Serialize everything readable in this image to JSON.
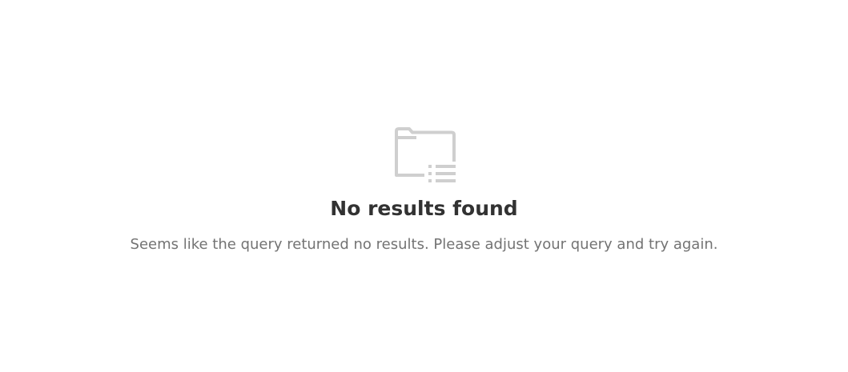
{
  "empty_state": {
    "icon": "folder-list-icon",
    "title": "No results found",
    "message": "Seems like the query returned no results. Please adjust your query and try again."
  },
  "colors": {
    "icon": "#cfcfcf",
    "title": "#323232",
    "message": "#737373",
    "background": "#ffffff"
  }
}
